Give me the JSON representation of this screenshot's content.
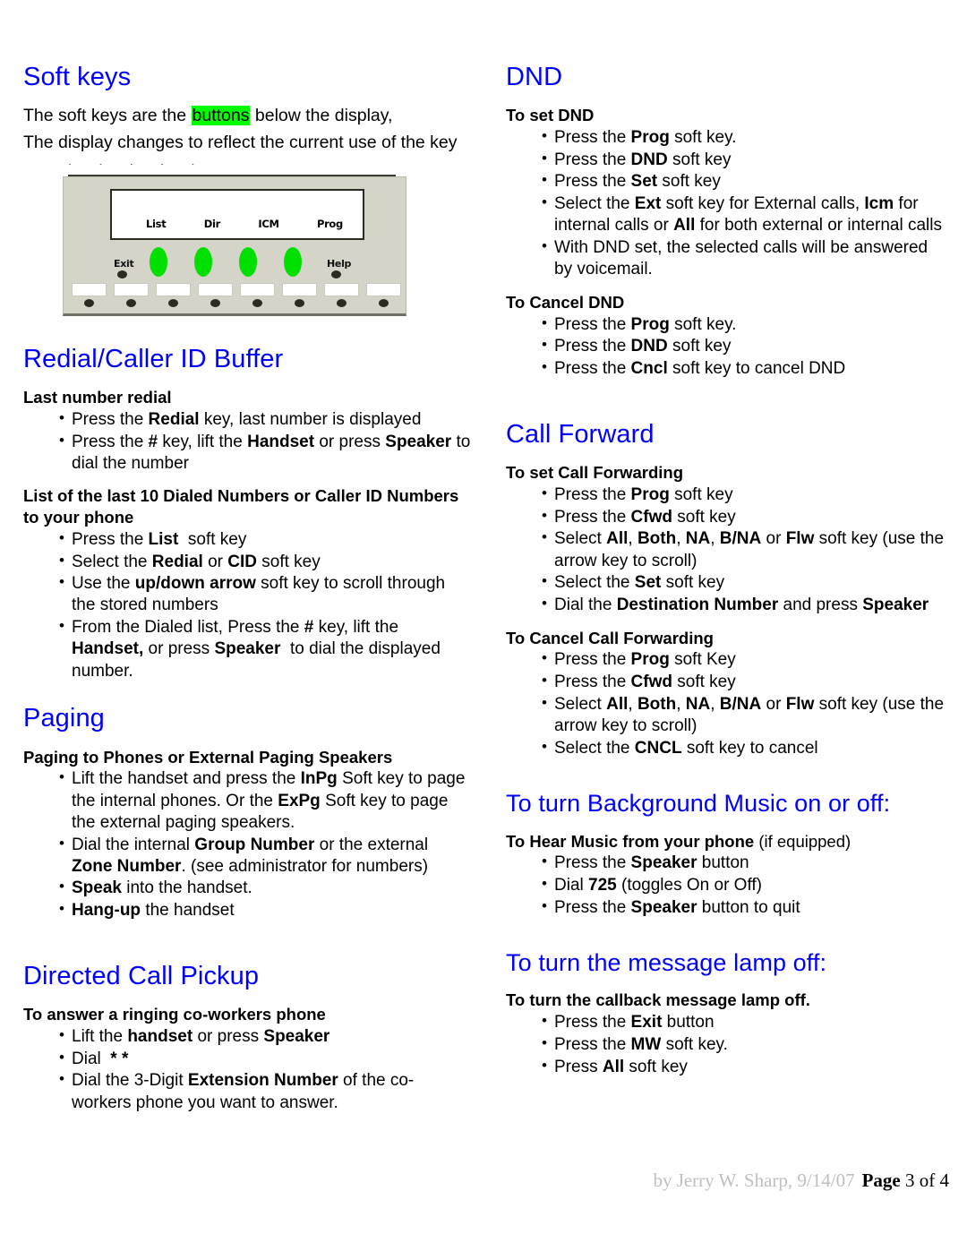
{
  "left_column": {
    "soft_keys": {
      "title": "Soft keys",
      "para_line1_a": "The soft keys are the ",
      "para_line1_highlight": "buttons",
      "para_line1_b": " below the display,",
      "para_line2": "The display changes to reflect the current use of the key",
      "phone_diagram": {
        "display_labels": [
          "List",
          "Dir",
          "ICM",
          "Prog"
        ],
        "exit_label": "Exit",
        "help_label": "Help",
        "green_key_count": 4,
        "bottom_key_count": 8
      }
    },
    "redial": {
      "title": "Redial/Caller ID Buffer",
      "sub1": "Last number redial",
      "sub1_items": [
        "Press the <b>Redial</b> key, last number is displayed",
        "Press the <b>#</b> key, lift the <b>Handset</b> or press <b>Speaker</b> to dial the number"
      ],
      "sub2": "List of the last 10 Dialed Numbers or Caller ID Numbers to your phone",
      "sub2_items": [
        "Press the <b>List</b>&nbsp; soft key",
        "Select the <b>Redial</b> or <b>CID</b> soft key",
        "Use the <b>up/down arrow</b> soft key to scroll through the stored numbers",
        "From the Dialed list, Press the <b>#</b> key, lift the <b>Handset,</b> or press <b>Speaker</b>&nbsp; to dial the displayed number."
      ]
    },
    "paging": {
      "title": "Paging",
      "sub1": "Paging to Phones or External Paging Speakers",
      "sub1_items": [
        "Lift the handset and press the <b>InPg</b> Soft key to page the internal phones. Or the <b>ExPg</b> Soft key to page the external paging speakers.",
        "Dial the internal <b>Group Number</b> or the external <b>Zone Number</b>. (see administrator for numbers)",
        "<b>Speak</b> into the handset.",
        "<b>Hang-up</b> the handset"
      ]
    },
    "pickup": {
      "title": "Directed Call Pickup",
      "sub1": "To answer a ringing co-workers phone",
      "sub1_items": [
        "Lift the <b>handset</b> or press <b>Speaker</b>",
        "Dial &nbsp;<b>* *</b>",
        "Dial the 3-Digit <b>Extension Number</b> of the co-workers phone you want to answer."
      ]
    }
  },
  "right_column": {
    "dnd": {
      "title": "DND",
      "sub1": "To set DND",
      "sub1_items": [
        "Press the <b>Prog</b> soft key.",
        "Press the <b>DND</b> soft key",
        "Press the <b>Set</b> soft key",
        "Select the <b>Ext</b> soft key for External calls, <b>Icm</b> for internal calls or <b>All</b> for both external or internal calls",
        "With DND set, the selected calls will be answered by voicemail."
      ],
      "sub2": "To Cancel DND",
      "sub2_items": [
        "Press the <b>Prog</b> soft key.",
        "Press the <b>DND</b> soft key",
        "Press the <b>Cncl</b> soft key to cancel DND"
      ]
    },
    "call_forward": {
      "title": "Call Forward",
      "sub1": "To set Call Forwarding",
      "sub1_items": [
        "Press the <b>Prog</b> soft key",
        "Press the <b>Cfwd</b> soft key",
        "Select <b>All</b>, <b>Both</b>, <b>NA</b>, <b>B/NA</b> or <b>Flw</b> soft key (use the arrow key to scroll)",
        "Select the <b>Set</b> soft key",
        "Dial the <b>Destination Number</b> and press <b>Speaker</b>"
      ],
      "sub2": "To Cancel Call Forwarding",
      "sub2_items": [
        "Press the <b>Prog</b> soft Key",
        "Press the <b>Cfwd</b> soft key",
        "Select <b>All</b>, <b>Both</b>, <b>NA</b>, <b>B/NA</b> or <b>Flw</b> soft key (use the arrow key to scroll)",
        "Select the <b>CNCL</b> soft key to cancel"
      ]
    },
    "background_music": {
      "title": "To turn Background Music on or off:",
      "sub1_bold": "To Hear Music from your phone",
      "sub1_reg": " (if equipped)",
      "sub1_items": [
        "Press the <b>Speaker</b> button",
        "Dial <b>725</b> (toggles On or Off)",
        "Press the <b>Speaker</b> button to quit"
      ]
    },
    "message_lamp": {
      "title": "To turn the message lamp off:",
      "sub1": "To turn the callback message lamp off.",
      "sub1_items": [
        "Press the <b>Exit</b> button",
        "Press the <b>MW</b> soft key.",
        "Press <b>All</b> soft key"
      ]
    }
  },
  "footer": {
    "byline": "by Jerry W. Sharp, 9/14/07",
    "page_label": "Page",
    "page_value": " 3 of 4"
  },
  "colors": {
    "heading_blue": "#0000FF",
    "highlight_green": "#00FF00",
    "phone_body": "#D4D4C8",
    "softkey_green": "#00E000",
    "footer_gray": "#BFBFBF"
  }
}
